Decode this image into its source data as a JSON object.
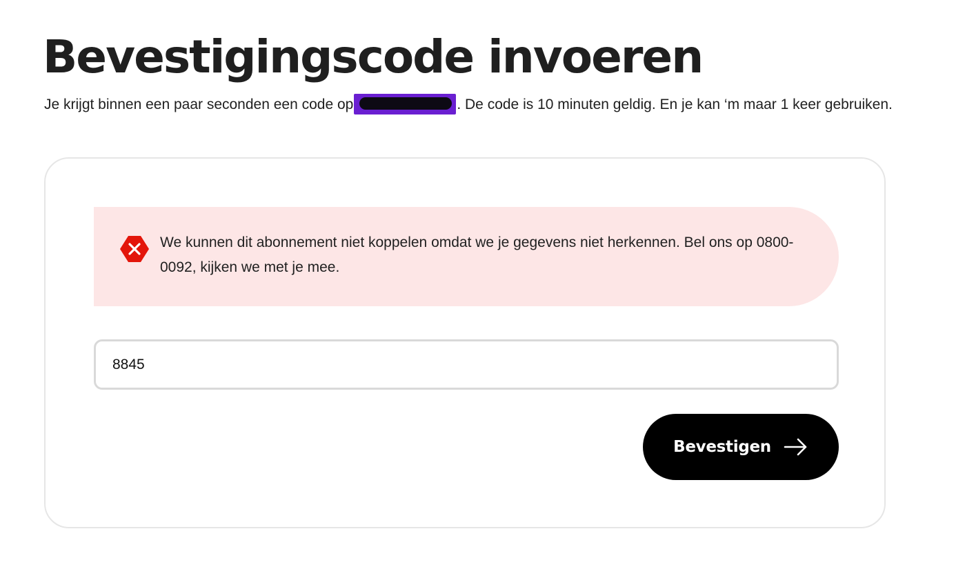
{
  "page": {
    "title": "Bevestigingscode invoeren",
    "intro_before": "Je krijgt binnen een paar seconden een code op",
    "intro_after": ". De code is 10 minuten geldig. En je kan ‘m maar 1 keer gebruiken."
  },
  "alert": {
    "icon": "error-x-icon",
    "color": "#e3160b",
    "background": "#fde6e6",
    "message": "We kunnen dit abonnement niet koppelen omdat we je gegevens niet herkennen. Bel ons op 0800-0092, kijken we met je mee."
  },
  "form": {
    "code_value": "8845",
    "submit_label": "Bevestigen",
    "submit_icon": "arrow-right-icon"
  },
  "colors": {
    "button_bg": "#000000",
    "card_border": "#e6e6e6",
    "redaction": "#6a1fd1"
  }
}
